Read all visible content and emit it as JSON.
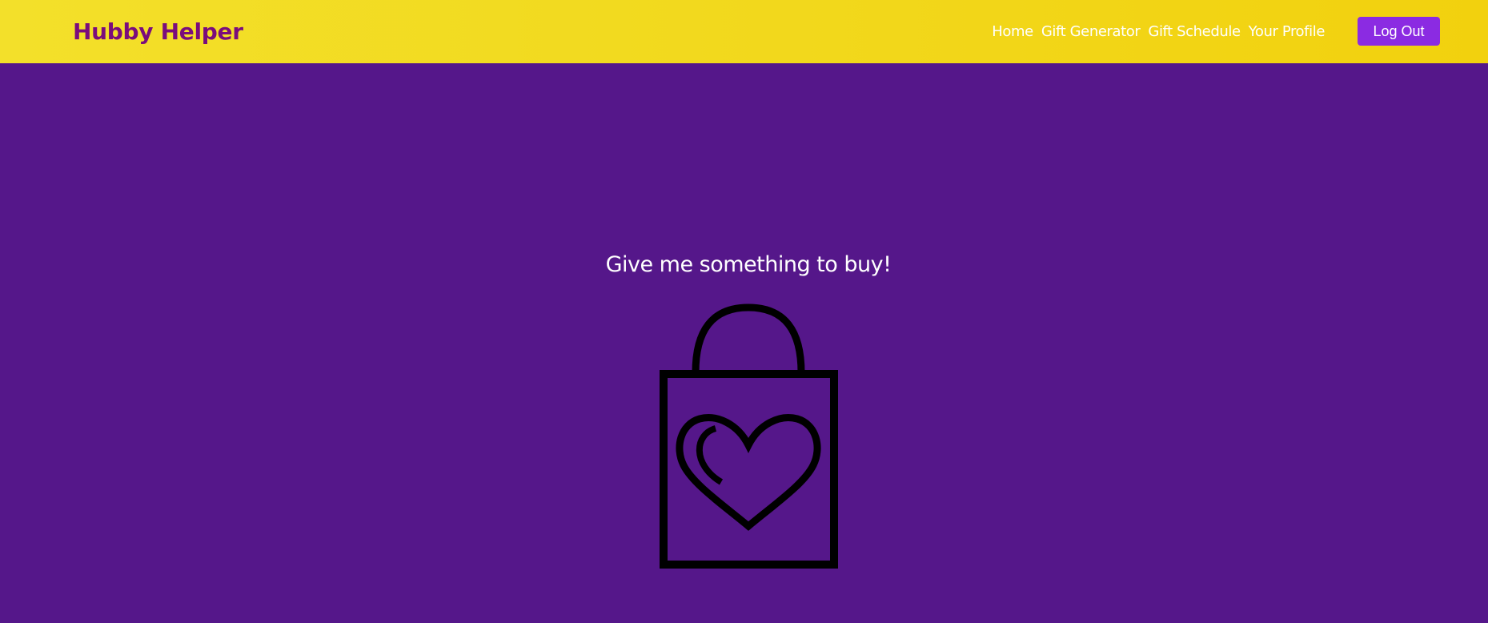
{
  "header": {
    "brand": "Hubby Helper",
    "nav": [
      {
        "label": "Home"
      },
      {
        "label": "Gift Generator"
      },
      {
        "label": "Gift Schedule"
      },
      {
        "label": "Your Profile"
      }
    ],
    "logout_label": "Log Out"
  },
  "main": {
    "prompt_text": "Give me something to buy!",
    "icon": "shopping-bag-heart-icon"
  },
  "colors": {
    "header_background": "#f2d91c",
    "brand_text": "#7a0d7c",
    "page_background": "#55178a",
    "button_background": "#8b2be2",
    "text_light": "#ffffff",
    "icon_stroke": "#000000"
  }
}
